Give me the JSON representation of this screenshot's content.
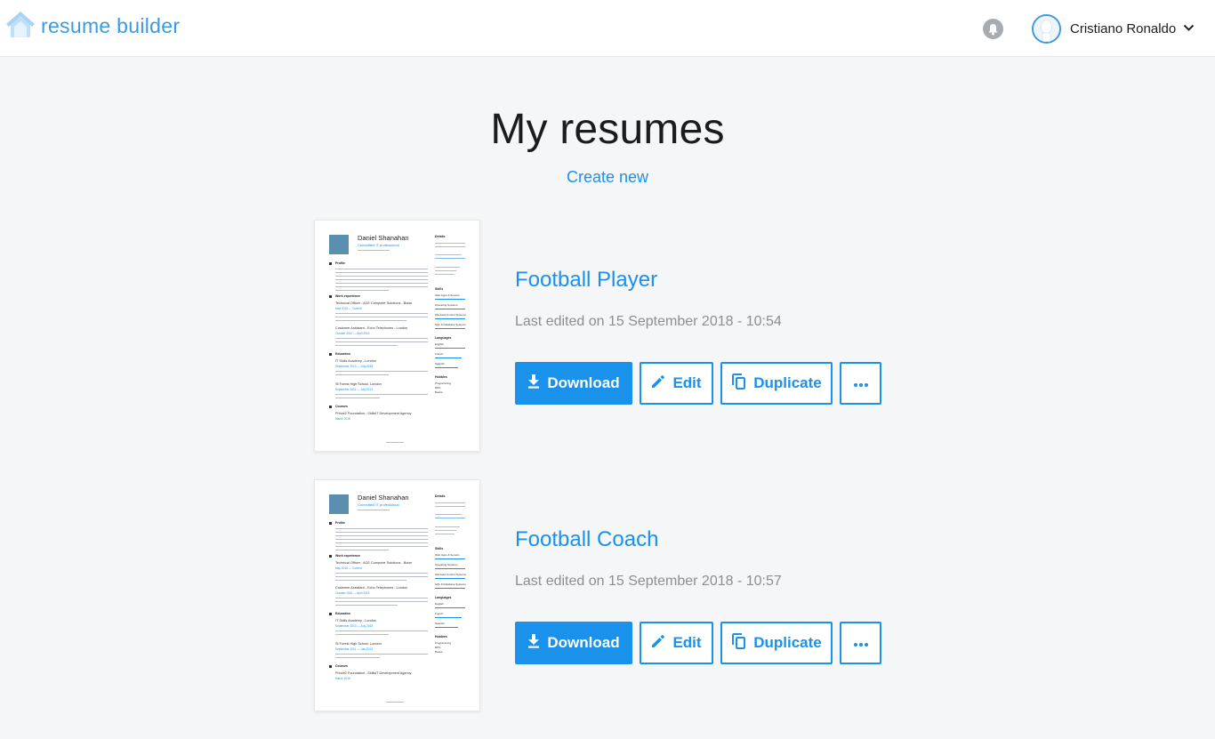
{
  "header": {
    "logo_text": "resume builder",
    "user_name": "Cristiano Ronaldo"
  },
  "page": {
    "title": "My resumes",
    "create_new": "Create new"
  },
  "actions": {
    "download": "Download",
    "edit": "Edit",
    "duplicate": "Duplicate"
  },
  "resumes": [
    {
      "title": "Football Player",
      "last_edited": "Last edited on 15 September 2018 - 10:54"
    },
    {
      "title": "Football Coach",
      "last_edited": "Last edited on 15 September 2018 - 10:57"
    }
  ],
  "thumbnail": {
    "name": "Daniel Shanahan",
    "subtitle": "Committed IT professional",
    "sections": {
      "profile": "Profile",
      "work": "Work experience",
      "education": "Education",
      "courses": "Courses",
      "details": "Details",
      "skills": "Skills",
      "languages": "Languages",
      "hobbies": "Hobbies"
    },
    "entries": {
      "job1": "Technical Officer - ACE Computer Solutions - Boise",
      "job1_date": "May 2015 — Current",
      "job2": "Customer Assistant - Echo Telephones - London",
      "job2_date": "October 2010 — April 2015",
      "edu1": "IT Skills Academy - London",
      "edu1_date": "September 2013 — July 2015",
      "edu2": "St Forest High School, London",
      "edu2_date": "September 2011 — July 2013",
      "course1": "Prince2 Foundation - SkillsIT Development Agency",
      "course1_date": "March 2016"
    },
    "skills": [
      "Web Apps & Servers",
      "Operating Systems",
      "Windows Control Systems",
      "SQL & Database Systems"
    ],
    "languages": [
      "English",
      "French",
      "Spanish"
    ],
    "hobbies": [
      "Programming",
      "RPG",
      "Books"
    ]
  }
}
